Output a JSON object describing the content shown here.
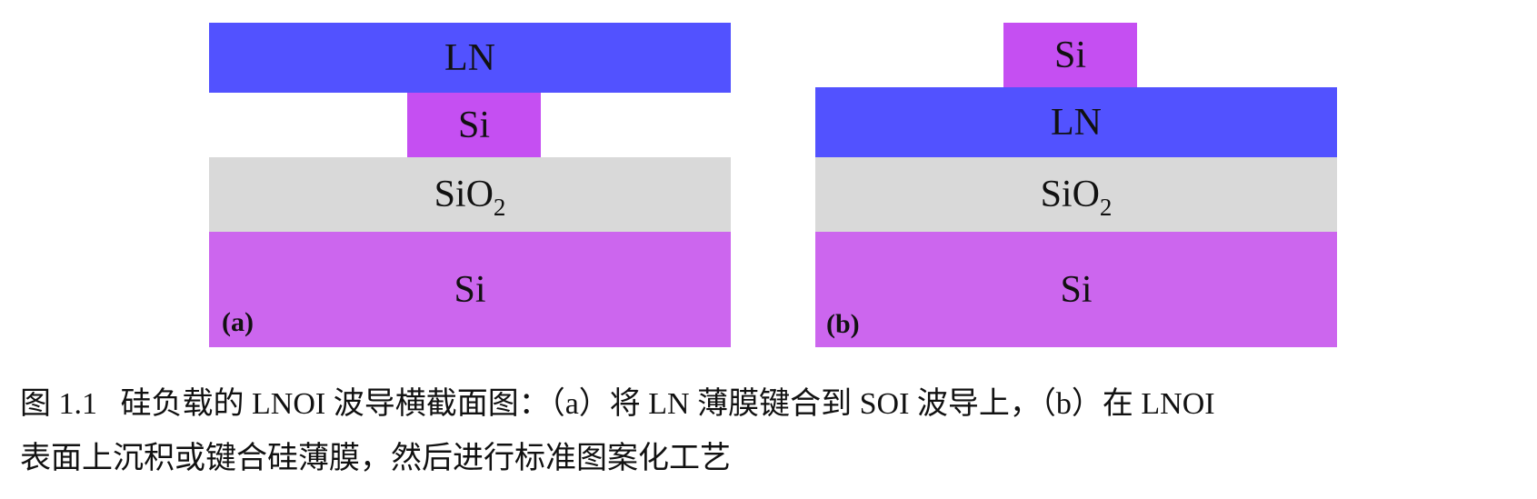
{
  "panel_a": {
    "label": "(a)",
    "layers": {
      "top": {
        "name": "LN",
        "color": "#5252FF"
      },
      "ridge": {
        "name": "Si",
        "color": "#C54FF2"
      },
      "oxide": {
        "name": "SiO",
        "subscript": "2",
        "color": "#D9D9D9"
      },
      "substrate": {
        "name": "Si",
        "color": "#CC66EE"
      }
    }
  },
  "panel_b": {
    "label": "(b)",
    "layers": {
      "ridge": {
        "name": "Si",
        "color": "#C54FF2"
      },
      "film": {
        "name": "LN",
        "color": "#5252FF"
      },
      "oxide": {
        "name": "SiO",
        "subscript": "2",
        "color": "#D9D9D9"
      },
      "substrate": {
        "name": "Si",
        "color": "#CC66EE"
      }
    }
  },
  "caption": {
    "figure_number": "图 1.1",
    "line1": "硅负载的 LNOI 波导横截面图：（a）将 LN 薄膜键合到 SOI 波导上，（b）在 LNOI",
    "line2": "表面上沉积或键合硅薄膜，然后进行标准图案化工艺"
  }
}
